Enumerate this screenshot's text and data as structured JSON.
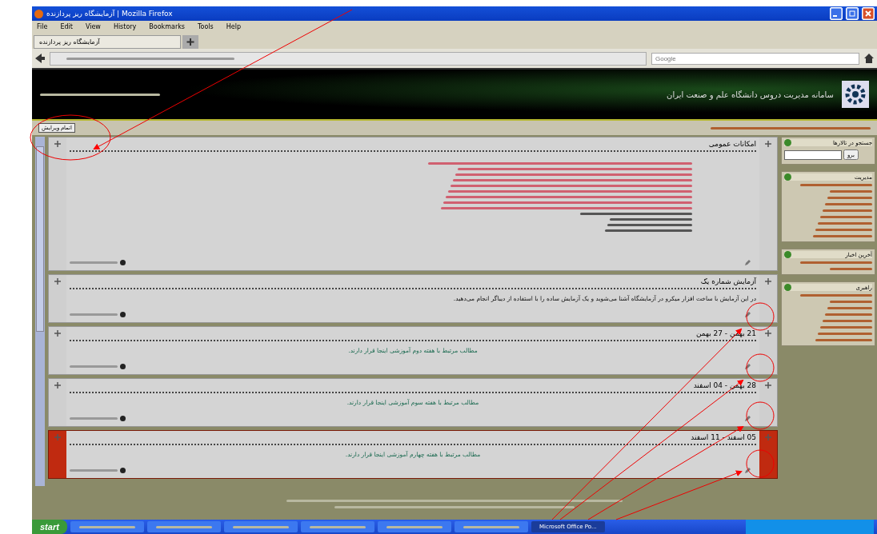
{
  "window": {
    "title": "آزمایشگاه ریز پردازنده | Mozilla Firefox"
  },
  "menu": {
    "file": "File",
    "edit": "Edit",
    "view": "View",
    "history": "History",
    "bookmarks": "Bookmarks",
    "tools": "Tools",
    "help": "Help"
  },
  "tabs": [
    {
      "label": "آزمایشگاه ریز پردازنده",
      "selected": true
    }
  ],
  "search": {
    "placeholder": "Google"
  },
  "site": {
    "title": "سامانه مدیریت دروس دانشگاه علم و صنعت ایران"
  },
  "edit_button": "اتمام ویرایش",
  "sections": [
    {
      "kind": "general",
      "title": "امکانات عمومی",
      "highlighted": false
    },
    {
      "kind": "topic",
      "title": "آزمایش شماره یک",
      "summary": "در این آزمایش با ساخت افزار میکرو در آزمایشگاه آشنا می‌شوید و یک آزمایش ساده را با استفاده از دیباگر انجام می‌دهید.",
      "highlighted": false
    },
    {
      "kind": "week",
      "title": "21 بهمن - 27 بهمن",
      "summary": "مطالب مرتبط با هفته دوم آموزشی اینجا قرار دارند.",
      "highlighted": false
    },
    {
      "kind": "week",
      "title": "28 بهمن - 04 اسفند",
      "summary": "مطالب مرتبط با هفته سوم آموزشی اینجا قرار دارند.",
      "highlighted": false
    },
    {
      "kind": "week",
      "title": "05 اسفند - 11 اسفند",
      "summary": "مطالب مرتبط با هفته چهارم آموزشی اینجا قرار دارند.",
      "highlighted": true
    }
  ],
  "sidebar": [
    {
      "kind": "search",
      "title": "جستجو در تالارها",
      "button": "برو"
    },
    {
      "kind": "list",
      "title": "مدیریت"
    },
    {
      "kind": "list",
      "title": "آخرین اخبار"
    },
    {
      "kind": "list",
      "title": "راهبری"
    }
  ],
  "taskbar": {
    "start": "start",
    "items": [
      {
        "label": "Microsoft Office Po...",
        "selected": true
      }
    ]
  }
}
